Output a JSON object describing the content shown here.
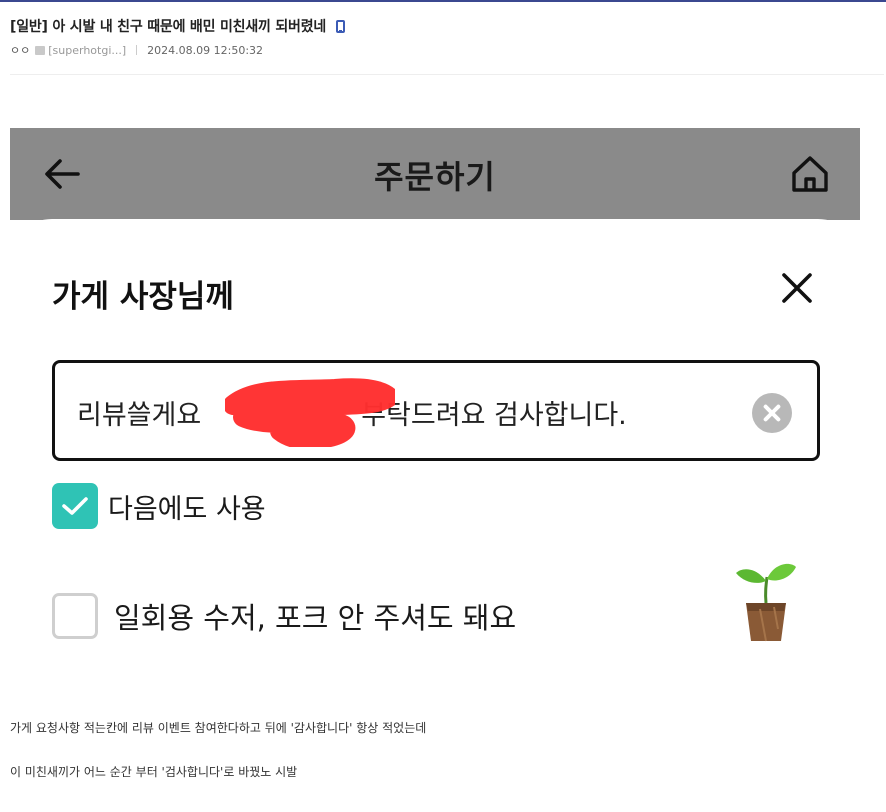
{
  "post": {
    "title": "[일반] 아 시발 내 친구 때문에 배민 미친새끼 되버렸네",
    "writer": "ㅇㅇ",
    "user_id": "[superhotgi...]",
    "date": "2024.08.09 12:50:32"
  },
  "screenshot": {
    "page_title": "주문하기",
    "sheet_title": "가게 사장님께",
    "request_text_before": "리뷰쓸게요",
    "request_text_after": "부탁드려요 검사합니다.",
    "checkboxes": [
      {
        "label": "다음에도 사용",
        "checked": true
      },
      {
        "label": "일회용 수저, 포크 안 주셔도 돼요",
        "checked": false
      }
    ],
    "colors": {
      "header_bar": "#8a8a8a",
      "check_accent": "#2fc3b5",
      "redaction": "#ff2e2e"
    },
    "icons": [
      "back-arrow-icon",
      "home-icon",
      "close-icon",
      "clear-input-icon",
      "checkmark-icon",
      "sprout-icon"
    ]
  },
  "captions": [
    "가게 요청사항 적는칸에 리뷰 이벤트 참여한다하고 뒤에 '감사합니다' 항상 적었는데",
    "이 미친새끼가 어느 순간 부터 '검사합니다'로 바꿨노 시발"
  ]
}
